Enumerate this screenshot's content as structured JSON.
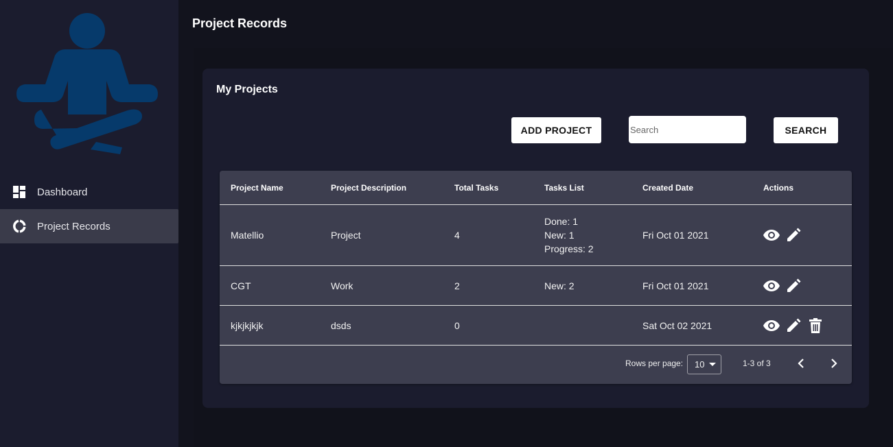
{
  "sidebar": {
    "items": [
      {
        "label": "Dashboard",
        "icon": "dashboard-icon"
      },
      {
        "label": "Project Records",
        "icon": "donut-chart-icon",
        "active": true
      }
    ]
  },
  "header": {
    "title": "Project Records"
  },
  "card": {
    "title": "My Projects",
    "add_button": "ADD PROJECT",
    "search_placeholder": "Search",
    "search_value": "",
    "search_button": "SEARCH"
  },
  "table": {
    "columns": [
      "Project Name",
      "Project Description",
      "Total Tasks",
      "Tasks List",
      "Created Date",
      "Actions"
    ],
    "rows": [
      {
        "name": "Matellio",
        "description": "Project",
        "total": "4",
        "tasks": [
          "Done: 1",
          "New: 1",
          "Progress: 2"
        ],
        "date": "Fri Oct 01 2021",
        "actions": [
          "view",
          "edit"
        ]
      },
      {
        "name": "CGT",
        "description": "Work",
        "total": "2",
        "tasks": [
          "New: 2"
        ],
        "date": "Fri Oct 01 2021",
        "actions": [
          "view",
          "edit"
        ]
      },
      {
        "name": "kjkjkjkjk",
        "description": "dsds",
        "total": "0",
        "tasks": [],
        "date": "Sat Oct 02 2021",
        "actions": [
          "view",
          "edit",
          "delete"
        ]
      }
    ]
  },
  "pagination": {
    "rows_per_page_label": "Rows per page:",
    "rows_per_page": "10",
    "range": "1-3 of 3"
  },
  "colors": {
    "logo": "#063a6b",
    "sidebar": "#1b1c2e",
    "table": "#3d3e4f",
    "active_item": "#3a3b4a"
  }
}
